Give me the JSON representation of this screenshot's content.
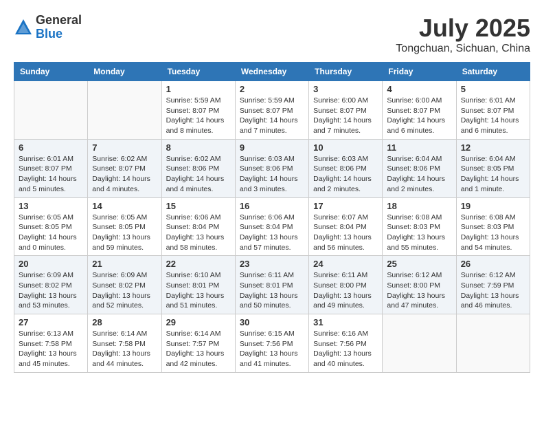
{
  "header": {
    "logo_general": "General",
    "logo_blue": "Blue",
    "month_title": "July 2025",
    "location": "Tongchuan, Sichuan, China"
  },
  "calendar": {
    "days_of_week": [
      "Sunday",
      "Monday",
      "Tuesday",
      "Wednesday",
      "Thursday",
      "Friday",
      "Saturday"
    ],
    "weeks": [
      [
        {
          "day": "",
          "info": ""
        },
        {
          "day": "",
          "info": ""
        },
        {
          "day": "1",
          "info": "Sunrise: 5:59 AM\nSunset: 8:07 PM\nDaylight: 14 hours and 8 minutes."
        },
        {
          "day": "2",
          "info": "Sunrise: 5:59 AM\nSunset: 8:07 PM\nDaylight: 14 hours and 7 minutes."
        },
        {
          "day": "3",
          "info": "Sunrise: 6:00 AM\nSunset: 8:07 PM\nDaylight: 14 hours and 7 minutes."
        },
        {
          "day": "4",
          "info": "Sunrise: 6:00 AM\nSunset: 8:07 PM\nDaylight: 14 hours and 6 minutes."
        },
        {
          "day": "5",
          "info": "Sunrise: 6:01 AM\nSunset: 8:07 PM\nDaylight: 14 hours and 6 minutes."
        }
      ],
      [
        {
          "day": "6",
          "info": "Sunrise: 6:01 AM\nSunset: 8:07 PM\nDaylight: 14 hours and 5 minutes."
        },
        {
          "day": "7",
          "info": "Sunrise: 6:02 AM\nSunset: 8:07 PM\nDaylight: 14 hours and 4 minutes."
        },
        {
          "day": "8",
          "info": "Sunrise: 6:02 AM\nSunset: 8:06 PM\nDaylight: 14 hours and 4 minutes."
        },
        {
          "day": "9",
          "info": "Sunrise: 6:03 AM\nSunset: 8:06 PM\nDaylight: 14 hours and 3 minutes."
        },
        {
          "day": "10",
          "info": "Sunrise: 6:03 AM\nSunset: 8:06 PM\nDaylight: 14 hours and 2 minutes."
        },
        {
          "day": "11",
          "info": "Sunrise: 6:04 AM\nSunset: 8:06 PM\nDaylight: 14 hours and 2 minutes."
        },
        {
          "day": "12",
          "info": "Sunrise: 6:04 AM\nSunset: 8:05 PM\nDaylight: 14 hours and 1 minute."
        }
      ],
      [
        {
          "day": "13",
          "info": "Sunrise: 6:05 AM\nSunset: 8:05 PM\nDaylight: 14 hours and 0 minutes."
        },
        {
          "day": "14",
          "info": "Sunrise: 6:05 AM\nSunset: 8:05 PM\nDaylight: 13 hours and 59 minutes."
        },
        {
          "day": "15",
          "info": "Sunrise: 6:06 AM\nSunset: 8:04 PM\nDaylight: 13 hours and 58 minutes."
        },
        {
          "day": "16",
          "info": "Sunrise: 6:06 AM\nSunset: 8:04 PM\nDaylight: 13 hours and 57 minutes."
        },
        {
          "day": "17",
          "info": "Sunrise: 6:07 AM\nSunset: 8:04 PM\nDaylight: 13 hours and 56 minutes."
        },
        {
          "day": "18",
          "info": "Sunrise: 6:08 AM\nSunset: 8:03 PM\nDaylight: 13 hours and 55 minutes."
        },
        {
          "day": "19",
          "info": "Sunrise: 6:08 AM\nSunset: 8:03 PM\nDaylight: 13 hours and 54 minutes."
        }
      ],
      [
        {
          "day": "20",
          "info": "Sunrise: 6:09 AM\nSunset: 8:02 PM\nDaylight: 13 hours and 53 minutes."
        },
        {
          "day": "21",
          "info": "Sunrise: 6:09 AM\nSunset: 8:02 PM\nDaylight: 13 hours and 52 minutes."
        },
        {
          "day": "22",
          "info": "Sunrise: 6:10 AM\nSunset: 8:01 PM\nDaylight: 13 hours and 51 minutes."
        },
        {
          "day": "23",
          "info": "Sunrise: 6:11 AM\nSunset: 8:01 PM\nDaylight: 13 hours and 50 minutes."
        },
        {
          "day": "24",
          "info": "Sunrise: 6:11 AM\nSunset: 8:00 PM\nDaylight: 13 hours and 49 minutes."
        },
        {
          "day": "25",
          "info": "Sunrise: 6:12 AM\nSunset: 8:00 PM\nDaylight: 13 hours and 47 minutes."
        },
        {
          "day": "26",
          "info": "Sunrise: 6:12 AM\nSunset: 7:59 PM\nDaylight: 13 hours and 46 minutes."
        }
      ],
      [
        {
          "day": "27",
          "info": "Sunrise: 6:13 AM\nSunset: 7:58 PM\nDaylight: 13 hours and 45 minutes."
        },
        {
          "day": "28",
          "info": "Sunrise: 6:14 AM\nSunset: 7:58 PM\nDaylight: 13 hours and 44 minutes."
        },
        {
          "day": "29",
          "info": "Sunrise: 6:14 AM\nSunset: 7:57 PM\nDaylight: 13 hours and 42 minutes."
        },
        {
          "day": "30",
          "info": "Sunrise: 6:15 AM\nSunset: 7:56 PM\nDaylight: 13 hours and 41 minutes."
        },
        {
          "day": "31",
          "info": "Sunrise: 6:16 AM\nSunset: 7:56 PM\nDaylight: 13 hours and 40 minutes."
        },
        {
          "day": "",
          "info": ""
        },
        {
          "day": "",
          "info": ""
        }
      ]
    ]
  }
}
